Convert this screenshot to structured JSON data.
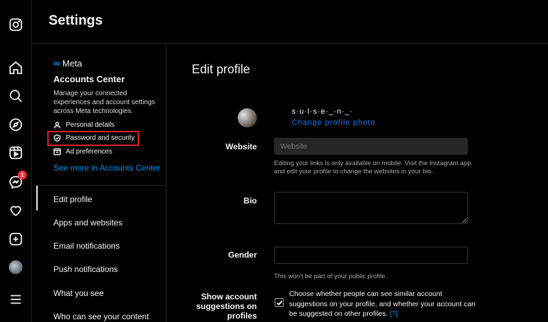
{
  "app": {
    "title": "Settings"
  },
  "rail": {
    "icons": [
      "instagram-icon",
      "home-icon",
      "search-icon",
      "explore-icon",
      "reels-icon",
      "messenger-icon",
      "heart-icon",
      "create-icon",
      "profile-avatar",
      "menu-icon"
    ],
    "messages_badge": "1"
  },
  "accounts_center": {
    "brand": "Meta",
    "title": "Accounts Center",
    "description": "Manage your connected experiences and account settings across Meta technologies.",
    "items": [
      {
        "label": "Personal details",
        "icon": "person-icon"
      },
      {
        "label": "Password and security",
        "icon": "shield-icon"
      },
      {
        "label": "Ad preferences",
        "icon": "ad-icon"
      }
    ],
    "see_more": "See more in Accounts Center"
  },
  "nav": {
    "items": [
      "Edit profile",
      "Apps and websites",
      "Email notifications",
      "Push notifications",
      "What you see",
      "Who can see your content"
    ],
    "active": "Edit profile"
  },
  "main": {
    "title": "Edit profile",
    "username": "s·u·l·s·e·_·n·_·",
    "change_photo": "Change profile photo",
    "website_label": "Website",
    "website_placeholder": "Website",
    "website_help": "Editing your links is only available on mobile. Visit the Instagram app and edit your profile to change the websites in your bio.",
    "bio_label": "Bio",
    "gender_label": "Gender",
    "gender_value": "",
    "gender_help": "This won't be part of your public profile.",
    "suggestions_label": "Show account suggestions on profiles",
    "suggestions_text": "Choose whether people can see similar account suggestions on your profile, and whether your account can be suggested on other profiles.",
    "suggestions_link": "[?]",
    "suggestions_checked": true
  },
  "colors": {
    "accent": "#0095f6",
    "highlight": "#e0202a",
    "badge": "#ff3040"
  }
}
